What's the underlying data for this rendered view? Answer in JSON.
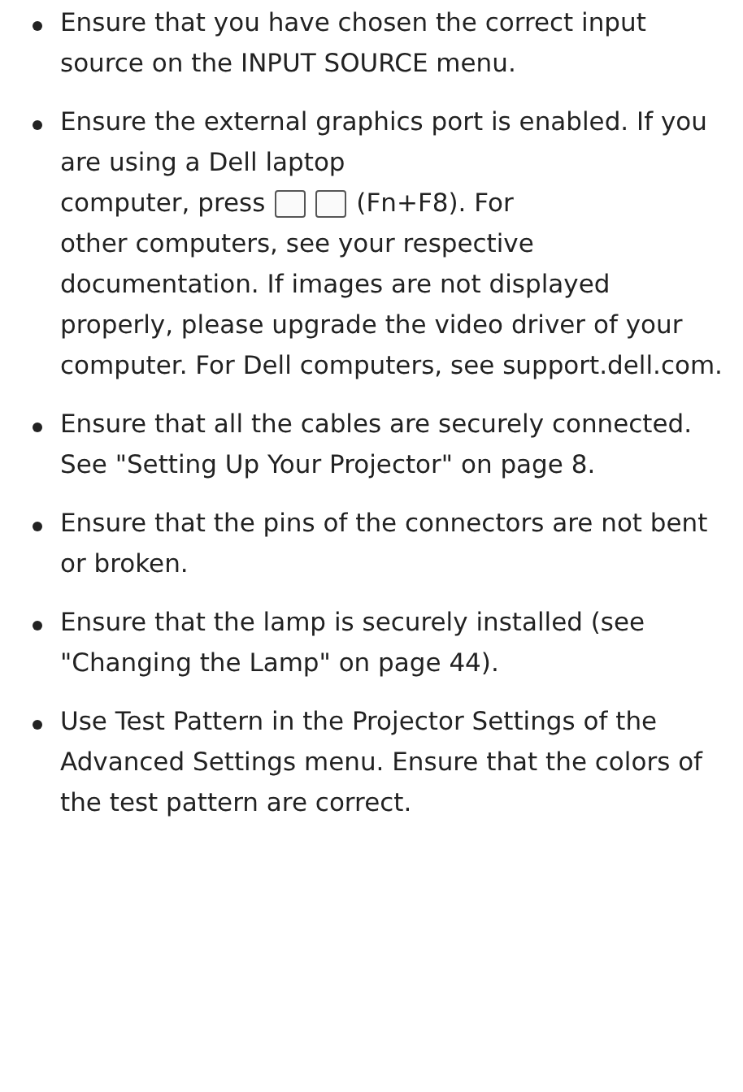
{
  "items": [
    {
      "segments": [
        {
          "kind": "text",
          "text": "Ensure that you have chosen the correct input source on the INPUT SOURCE menu."
        }
      ]
    },
    {
      "segments": [
        {
          "kind": "text",
          "text": "Ensure the external graphics port is enabled. If you are using a Dell laptop"
        },
        {
          "kind": "row",
          "parts": [
            {
              "kind": "text",
              "text": "computer, press"
            },
            {
              "kind": "key"
            },
            {
              "kind": "key"
            },
            {
              "kind": "text",
              "text": "(Fn+F8). For"
            }
          ]
        },
        {
          "kind": "text",
          "text": "other computers, see your respective documentation. If images are not displayed properly, please upgrade the video driver of your computer. For Dell computers, see support.dell.com."
        }
      ]
    },
    {
      "segments": [
        {
          "kind": "text",
          "text": "Ensure that all the cables are securely connected. See \"Setting Up Your Projector\" on page 8."
        }
      ]
    },
    {
      "segments": [
        {
          "kind": "text",
          "text": "Ensure that the pins of the connectors are not bent or broken."
        }
      ]
    },
    {
      "segments": [
        {
          "kind": "text",
          "text": "Ensure that the lamp is securely installed (see \"Changing the Lamp\" on page 44)."
        }
      ]
    },
    {
      "segments": [
        {
          "kind": "text",
          "text": "Use Test Pattern in the Projector Settings of the Advanced Settings menu. Ensure that the colors of the test pattern are correct."
        }
      ]
    }
  ]
}
